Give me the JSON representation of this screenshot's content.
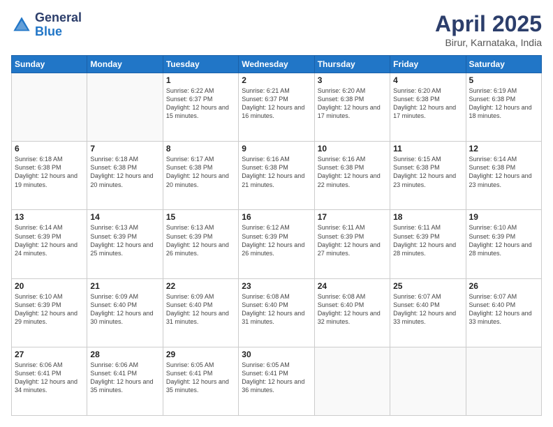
{
  "header": {
    "logo_line1": "General",
    "logo_line2": "Blue",
    "title": "April 2025",
    "subtitle": "Birur, Karnataka, India"
  },
  "days_of_week": [
    "Sunday",
    "Monday",
    "Tuesday",
    "Wednesday",
    "Thursday",
    "Friday",
    "Saturday"
  ],
  "weeks": [
    [
      {
        "day": "",
        "info": ""
      },
      {
        "day": "",
        "info": ""
      },
      {
        "day": "1",
        "info": "Sunrise: 6:22 AM\nSunset: 6:37 PM\nDaylight: 12 hours and 15 minutes."
      },
      {
        "day": "2",
        "info": "Sunrise: 6:21 AM\nSunset: 6:37 PM\nDaylight: 12 hours and 16 minutes."
      },
      {
        "day": "3",
        "info": "Sunrise: 6:20 AM\nSunset: 6:38 PM\nDaylight: 12 hours and 17 minutes."
      },
      {
        "day": "4",
        "info": "Sunrise: 6:20 AM\nSunset: 6:38 PM\nDaylight: 12 hours and 17 minutes."
      },
      {
        "day": "5",
        "info": "Sunrise: 6:19 AM\nSunset: 6:38 PM\nDaylight: 12 hours and 18 minutes."
      }
    ],
    [
      {
        "day": "6",
        "info": "Sunrise: 6:18 AM\nSunset: 6:38 PM\nDaylight: 12 hours and 19 minutes."
      },
      {
        "day": "7",
        "info": "Sunrise: 6:18 AM\nSunset: 6:38 PM\nDaylight: 12 hours and 20 minutes."
      },
      {
        "day": "8",
        "info": "Sunrise: 6:17 AM\nSunset: 6:38 PM\nDaylight: 12 hours and 20 minutes."
      },
      {
        "day": "9",
        "info": "Sunrise: 6:16 AM\nSunset: 6:38 PM\nDaylight: 12 hours and 21 minutes."
      },
      {
        "day": "10",
        "info": "Sunrise: 6:16 AM\nSunset: 6:38 PM\nDaylight: 12 hours and 22 minutes."
      },
      {
        "day": "11",
        "info": "Sunrise: 6:15 AM\nSunset: 6:38 PM\nDaylight: 12 hours and 23 minutes."
      },
      {
        "day": "12",
        "info": "Sunrise: 6:14 AM\nSunset: 6:38 PM\nDaylight: 12 hours and 23 minutes."
      }
    ],
    [
      {
        "day": "13",
        "info": "Sunrise: 6:14 AM\nSunset: 6:39 PM\nDaylight: 12 hours and 24 minutes."
      },
      {
        "day": "14",
        "info": "Sunrise: 6:13 AM\nSunset: 6:39 PM\nDaylight: 12 hours and 25 minutes."
      },
      {
        "day": "15",
        "info": "Sunrise: 6:13 AM\nSunset: 6:39 PM\nDaylight: 12 hours and 26 minutes."
      },
      {
        "day": "16",
        "info": "Sunrise: 6:12 AM\nSunset: 6:39 PM\nDaylight: 12 hours and 26 minutes."
      },
      {
        "day": "17",
        "info": "Sunrise: 6:11 AM\nSunset: 6:39 PM\nDaylight: 12 hours and 27 minutes."
      },
      {
        "day": "18",
        "info": "Sunrise: 6:11 AM\nSunset: 6:39 PM\nDaylight: 12 hours and 28 minutes."
      },
      {
        "day": "19",
        "info": "Sunrise: 6:10 AM\nSunset: 6:39 PM\nDaylight: 12 hours and 28 minutes."
      }
    ],
    [
      {
        "day": "20",
        "info": "Sunrise: 6:10 AM\nSunset: 6:39 PM\nDaylight: 12 hours and 29 minutes."
      },
      {
        "day": "21",
        "info": "Sunrise: 6:09 AM\nSunset: 6:40 PM\nDaylight: 12 hours and 30 minutes."
      },
      {
        "day": "22",
        "info": "Sunrise: 6:09 AM\nSunset: 6:40 PM\nDaylight: 12 hours and 31 minutes."
      },
      {
        "day": "23",
        "info": "Sunrise: 6:08 AM\nSunset: 6:40 PM\nDaylight: 12 hours and 31 minutes."
      },
      {
        "day": "24",
        "info": "Sunrise: 6:08 AM\nSunset: 6:40 PM\nDaylight: 12 hours and 32 minutes."
      },
      {
        "day": "25",
        "info": "Sunrise: 6:07 AM\nSunset: 6:40 PM\nDaylight: 12 hours and 33 minutes."
      },
      {
        "day": "26",
        "info": "Sunrise: 6:07 AM\nSunset: 6:40 PM\nDaylight: 12 hours and 33 minutes."
      }
    ],
    [
      {
        "day": "27",
        "info": "Sunrise: 6:06 AM\nSunset: 6:41 PM\nDaylight: 12 hours and 34 minutes."
      },
      {
        "day": "28",
        "info": "Sunrise: 6:06 AM\nSunset: 6:41 PM\nDaylight: 12 hours and 35 minutes."
      },
      {
        "day": "29",
        "info": "Sunrise: 6:05 AM\nSunset: 6:41 PM\nDaylight: 12 hours and 35 minutes."
      },
      {
        "day": "30",
        "info": "Sunrise: 6:05 AM\nSunset: 6:41 PM\nDaylight: 12 hours and 36 minutes."
      },
      {
        "day": "",
        "info": ""
      },
      {
        "day": "",
        "info": ""
      },
      {
        "day": "",
        "info": ""
      }
    ]
  ]
}
